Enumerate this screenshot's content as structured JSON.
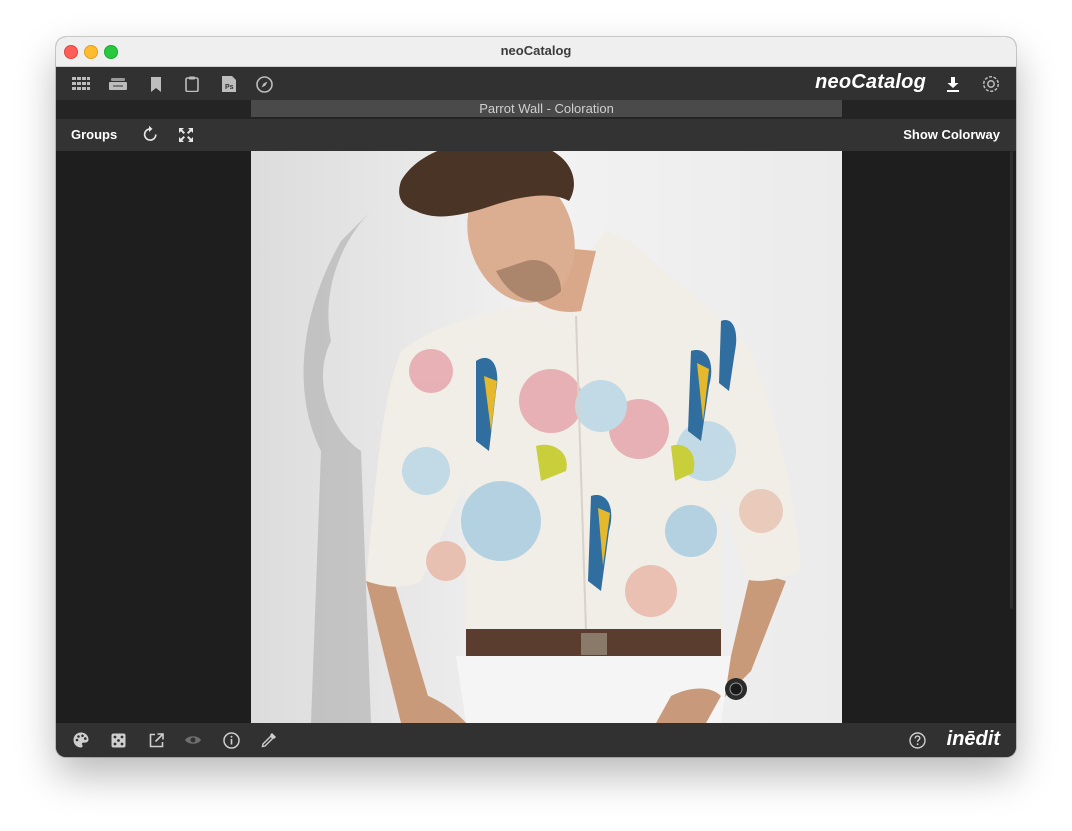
{
  "window": {
    "title": "neoCatalog"
  },
  "toolbar": {
    "brand": "neoCatalog",
    "icons": [
      "grid-icon",
      "stack-icon",
      "bookmark-icon",
      "clipboard-icon",
      "photoshop-icon",
      "compass-icon",
      "download-icon",
      "gear-icon"
    ],
    "photoshop_label": "Ps"
  },
  "document": {
    "title": "Parrot Wall - Coloration"
  },
  "subbar": {
    "groups_label": "Groups",
    "show_colorway_label": "Show Colorway"
  },
  "bottombar": {
    "icons": [
      "palette-icon",
      "dice-icon",
      "external-link-icon",
      "eye-icon",
      "info-icon",
      "eyedropper-icon",
      "help-icon"
    ],
    "brand": "inēdit"
  },
  "colors": {
    "panel": "#313131",
    "background": "#1e1e1e",
    "accent": "#ffffff"
  }
}
